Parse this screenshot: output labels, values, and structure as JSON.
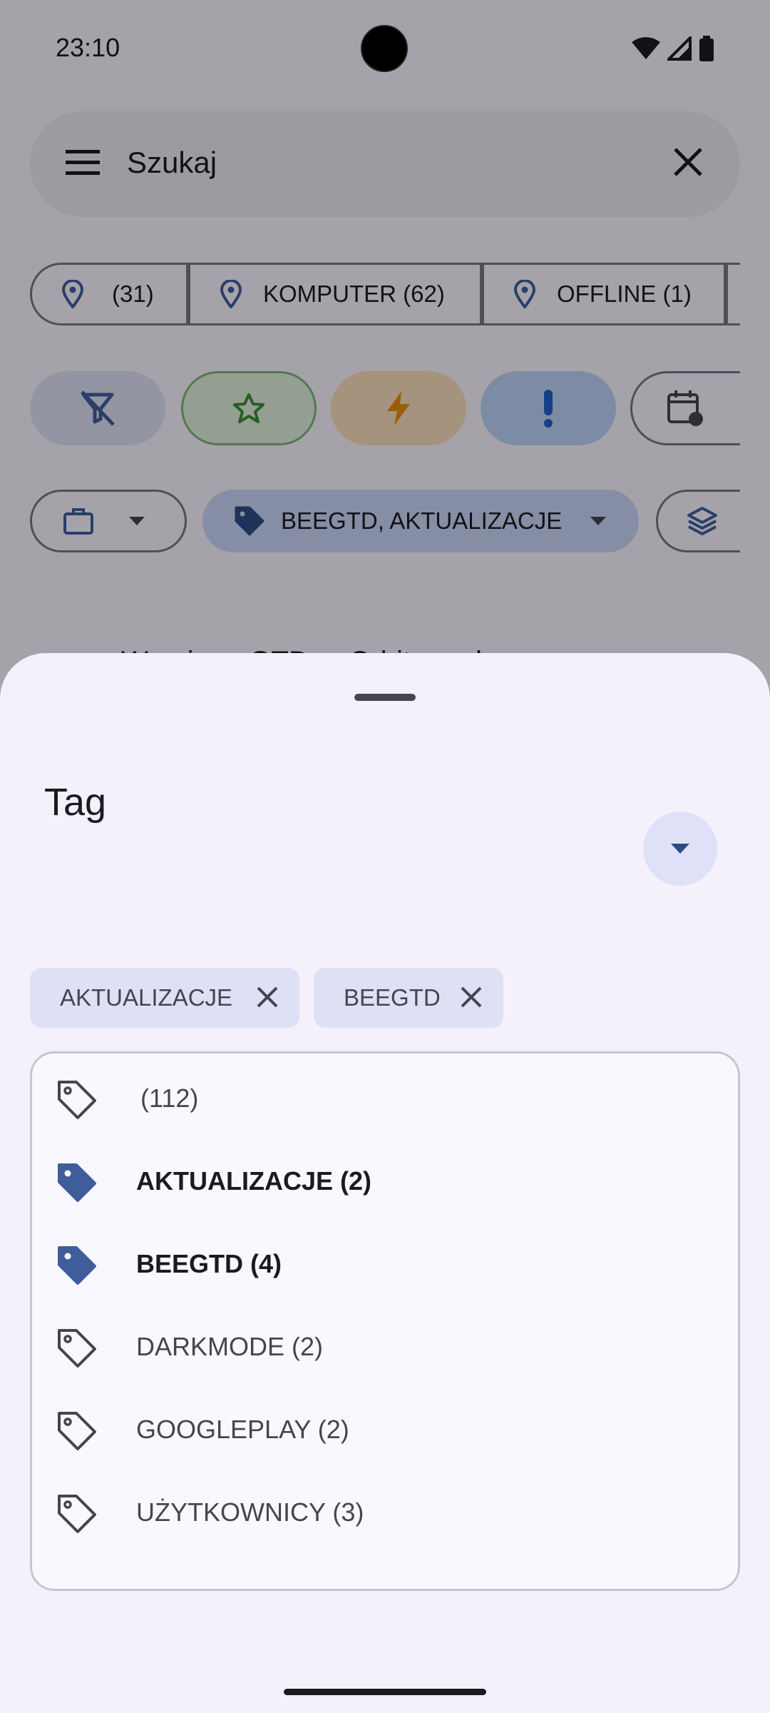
{
  "status_bar": {
    "time": "23:10"
  },
  "search": {
    "placeholder": "Szukaj"
  },
  "context_chips": [
    {
      "label": "(31)"
    },
    {
      "label": "KOMPUTER (62)"
    },
    {
      "label": "OFFLINE (1)"
    }
  ],
  "filter_chips": {
    "tag_chip_label": "BEEGTD, AKTUALIZACJE"
  },
  "background_snippet": "Wersja ... GTD ... Orbit ... nd",
  "sheet": {
    "title": "Tag",
    "selected_chips": [
      {
        "label": "AKTUALIZACJE"
      },
      {
        "label": "BEEGTD"
      }
    ],
    "tags": [
      {
        "label": "(112)",
        "selected": false
      },
      {
        "label": "AKTUALIZACJE (2)",
        "selected": true
      },
      {
        "label": "BEEGTD (4)",
        "selected": true
      },
      {
        "label": "DARKMODE (2)",
        "selected": false
      },
      {
        "label": "GOOGLEPLAY (2)",
        "selected": false
      },
      {
        "label": "UŻYTKOWNICY (3)",
        "selected": false
      }
    ]
  },
  "colors": {
    "accent": "#3f5d9b",
    "selected_chip_bg": "#dee0f6",
    "sheet_bg": "#f4f1fb"
  }
}
